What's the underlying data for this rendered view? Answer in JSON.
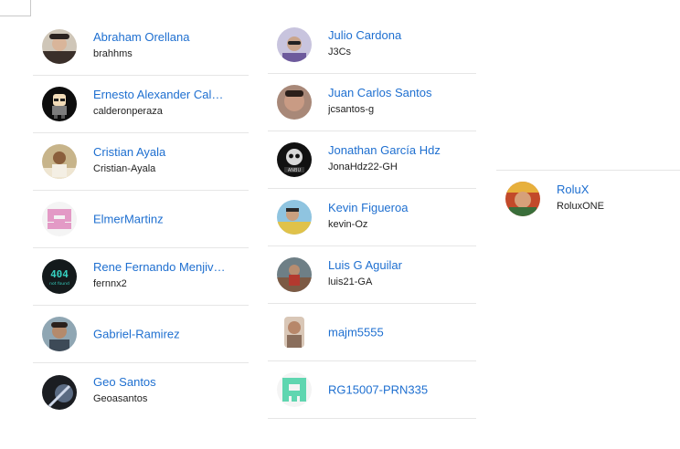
{
  "users": {
    "column1": [
      {
        "name": "Abraham Orellana",
        "login": "brahhms",
        "avatar_icon": "user-photo-avatar-icon"
      },
      {
        "name": "Ernesto Alexander Cal…",
        "login": "calderonperaza",
        "avatar_icon": "cartoon-avatar-icon"
      },
      {
        "name": "Cristian Ayala",
        "login": "Cristian-Ayala",
        "avatar_icon": "user-photo-avatar-icon"
      },
      {
        "name": "ElmerMartinz",
        "login": "",
        "avatar_icon": "identicon-avatar-icon"
      },
      {
        "name": "Rene Fernando Menjiv…",
        "login": "fernnx2",
        "avatar_icon": "404-avatar-icon"
      },
      {
        "name": "Gabriel-Ramirez",
        "login": "",
        "avatar_icon": "user-photo-avatar-icon"
      },
      {
        "name": "Geo Santos",
        "login": "Geoasantos",
        "avatar_icon": "user-photo-avatar-icon"
      }
    ],
    "column2": [
      {
        "name": "Julio Cardona",
        "login": "J3Cs",
        "avatar_icon": "user-photo-avatar-icon"
      },
      {
        "name": "Juan Carlos Santos",
        "login": "jcsantos-g",
        "avatar_icon": "user-photo-avatar-icon"
      },
      {
        "name": "Jonathan García Hdz",
        "login": "JonaHdz22-GH",
        "avatar_icon": "skull-avatar-icon"
      },
      {
        "name": "Kevin Figueroa",
        "login": "kevin-Oz",
        "avatar_icon": "user-photo-avatar-icon"
      },
      {
        "name": "Luis G Aguilar",
        "login": "luis21-GA",
        "avatar_icon": "user-photo-avatar-icon"
      },
      {
        "name": "majm5555",
        "login": "",
        "avatar_icon": "user-photo-avatar-icon"
      },
      {
        "name": "RG15007-PRN335",
        "login": "",
        "avatar_icon": "identicon-avatar-icon"
      }
    ],
    "column3": [
      {
        "name": "RoluX",
        "login": "RoluxONE",
        "avatar_icon": "user-photo-avatar-icon"
      }
    ]
  },
  "colors": {
    "link": "#1e6fd0",
    "text": "#222222",
    "divider": "#e6e6e6",
    "identicon_pink": "#e39ac6",
    "identicon_teal": "#5fd6b0"
  }
}
